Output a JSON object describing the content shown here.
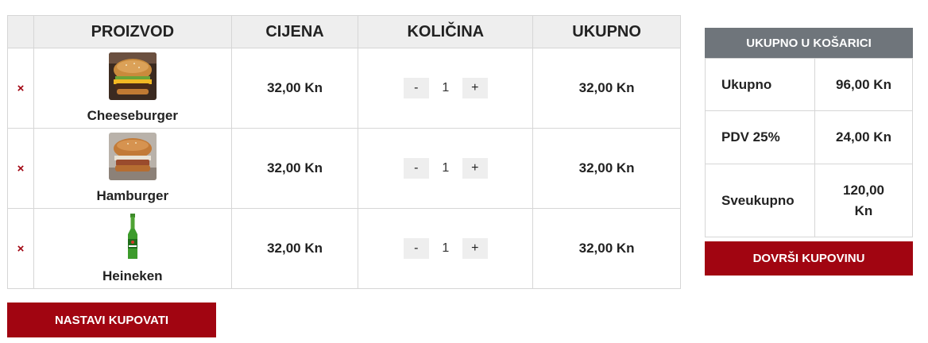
{
  "cart": {
    "headers": {
      "product": "PROIZVOD",
      "price": "CIJENA",
      "quantity": "KOLIČINA",
      "total": "UKUPNO"
    },
    "remove_glyph": "×",
    "minus_label": "-",
    "plus_label": "+",
    "items": [
      {
        "name": "Cheeseburger",
        "price": "32,00 Kn",
        "quantity": "1",
        "total": "32,00 Kn",
        "image_icon": "cheeseburger-image"
      },
      {
        "name": "Hamburger",
        "price": "32,00 Kn",
        "quantity": "1",
        "total": "32,00 Kn",
        "image_icon": "hamburger-image"
      },
      {
        "name": "Heineken",
        "price": "32,00 Kn",
        "quantity": "1",
        "total": "32,00 Kn",
        "image_icon": "beer-bottle-image"
      }
    ]
  },
  "summary": {
    "title": "UKUPNO U KOŠARICI",
    "subtotal_label": "Ukupno",
    "subtotal_value": "96,00 Kn",
    "vat_label": "PDV 25%",
    "vat_value": "24,00 Kn",
    "grand_label": "Sveukupno",
    "grand_value": "120,00 Kn"
  },
  "buttons": {
    "continue_shopping": "NASTAVI KUPOVATI",
    "checkout": "DOVRŠI KUPOVINU"
  },
  "colors": {
    "accent_red": "#a10511",
    "summary_header": "#6f757b",
    "header_bg": "#eeeeee"
  }
}
